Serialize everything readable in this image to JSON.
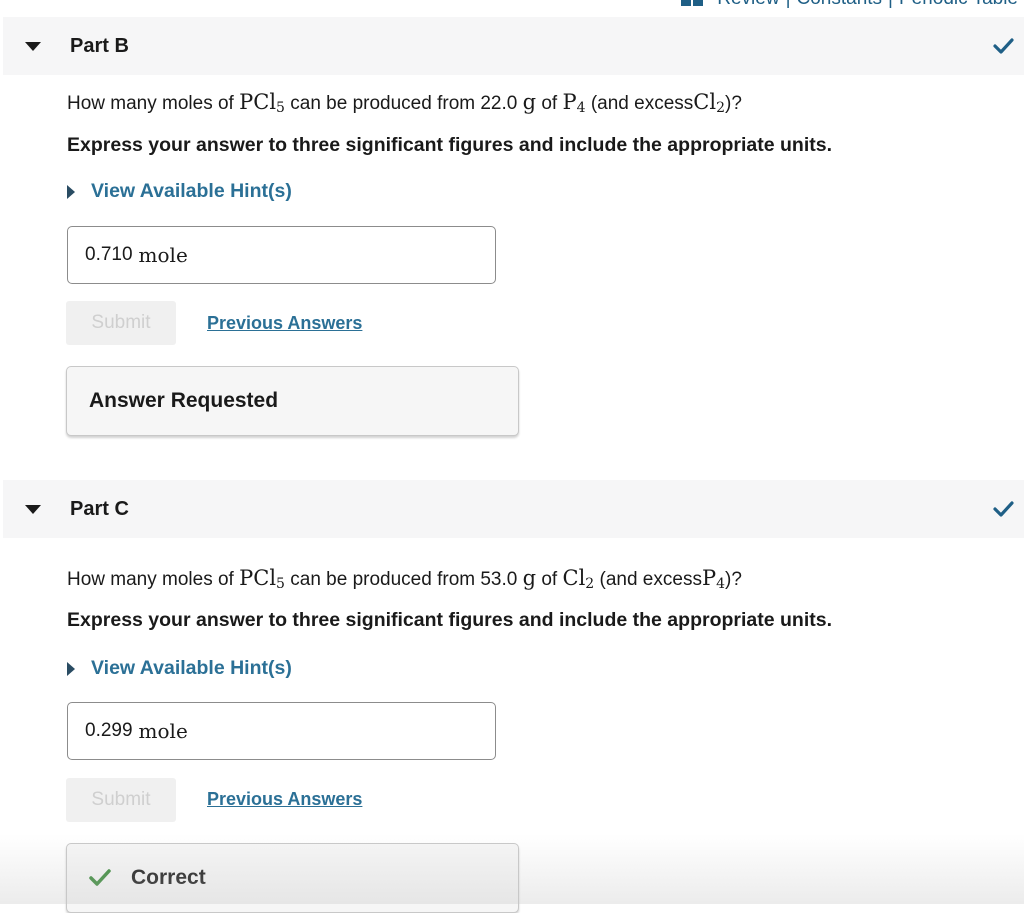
{
  "top_links": {
    "review": "Review",
    "constants": "Constants",
    "periodic_table": "Periodic Table",
    "separator": "|"
  },
  "colors": {
    "link": "#2b7096",
    "check": "#1f5f86",
    "correct_green": "#3a8a3a"
  },
  "parts": [
    {
      "title": "Part B",
      "question_prefix": "How many moles of",
      "compound": "PCl",
      "compound_sub": "5",
      "question_mid": "can be produced from 22.0",
      "mass_unit": "g",
      "question_of": "of",
      "reactant": "P",
      "reactant_sub": "4",
      "question_excess": "(and excess",
      "excess": "Cl",
      "excess_sub": "2",
      "question_end": ")?",
      "instruction": "Express your answer to three significant figures and include the appropriate units.",
      "hint_label": "View Available Hint(s)",
      "answer_value": "0.710",
      "answer_unit": "mole",
      "submit_label": "Submit",
      "previous_answers_label": "Previous Answers",
      "feedback": "Answer Requested"
    },
    {
      "title": "Part C",
      "question_prefix": "How many moles of",
      "compound": "PCl",
      "compound_sub": "5",
      "question_mid": "can be produced from 53.0",
      "mass_unit": "g",
      "question_of": "of",
      "reactant": "Cl",
      "reactant_sub": "2",
      "question_excess": "(and excess",
      "excess": "P",
      "excess_sub": "4",
      "question_end": ")?",
      "instruction": "Express your answer to three significant figures and include the appropriate units.",
      "hint_label": "View Available Hint(s)",
      "answer_value": "0.299",
      "answer_unit": "mole",
      "submit_label": "Submit",
      "previous_answers_label": "Previous Answers",
      "feedback": "Correct"
    }
  ]
}
